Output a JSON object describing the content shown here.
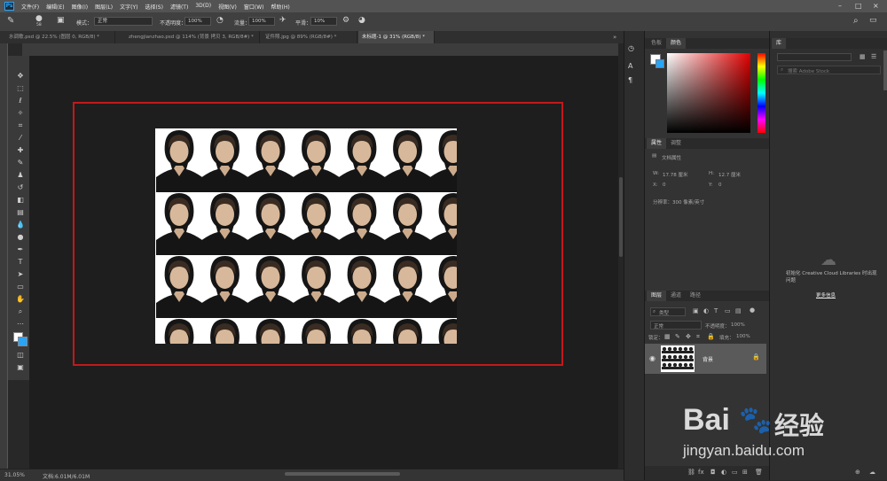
{
  "app": {
    "logo": "Ps",
    "menu": [
      "文件(F)",
      "编辑(E)",
      "图像(I)",
      "图层(L)",
      "文字(Y)",
      "选择(S)",
      "滤镜(T)",
      "3D(D)",
      "视图(V)",
      "窗口(W)",
      "帮助(H)"
    ],
    "window_controls": {
      "minimize": "–",
      "maximize": "□",
      "close": "×"
    }
  },
  "options": {
    "brush_size": "58",
    "mode_label": "模式：",
    "mode_value": "正常",
    "opacity_label": "不透明度：",
    "opacity_value": "100%",
    "flow_label": "流量：",
    "flow_value": "100%",
    "smoothing_label": "平滑：",
    "smoothing_value": "10%"
  },
  "tabs": [
    {
      "label": "水调歌.psd @ 22.5% (图层 0, RGB/8) *",
      "active": false
    },
    {
      "label": "zhengjianzhao.psd @ 114% (背景 拷贝 3, RGB/8#) *",
      "active": false
    },
    {
      "label": "证件照.jpg @ 89% (RGB/8#) *",
      "active": false
    },
    {
      "label": "未标题-1 @ 31% (RGB/8) *",
      "active": true
    }
  ],
  "status": {
    "zoom": "31.05%",
    "doc": "文档:6.01M/6.01M"
  },
  "panels": {
    "top_tabs": [
      "色板",
      "颜色"
    ],
    "top_tab_active": "颜色",
    "lib_tab": "库",
    "search_placeholder": "搜索 Adobe Stock",
    "props_tabs": [
      "属性",
      "调整"
    ],
    "props_title": "文档属性",
    "w_label": "W:",
    "w_value": "17.78 厘米",
    "h_label": "H:",
    "h_value": "12.7 厘米",
    "x_label": "X:",
    "x_value": "0",
    "y_label": "Y:",
    "y_value": "0",
    "resolution": "分辨率：300 像素/英寸",
    "layer_tabs": [
      "图层",
      "通道",
      "路径"
    ],
    "layer_kind": "类型",
    "blend_mode": "正常",
    "opacity_label": "不透明度：",
    "opacity_value": "100%",
    "lock_label": "锁定：",
    "fill_label": "填充：",
    "fill_value": "100%",
    "layer_name": "背景",
    "cc_message": "初始化 Creative Cloud Libraries 时出现问题",
    "more_info": "更多信息"
  },
  "watermark": {
    "brand": "Bai",
    "brand2": "经验",
    "url": "jingyan.baidu.com"
  },
  "colors": {
    "accent": "#2aa4f5",
    "frame_red": "#c2191b",
    "picker_red": "#e00000"
  }
}
